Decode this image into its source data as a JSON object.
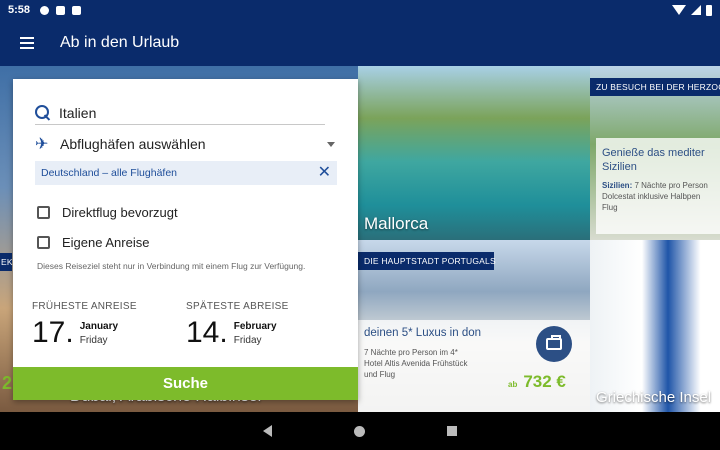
{
  "status_bar": {
    "time": "5:58",
    "icons": [
      "settings-icon",
      "a-icon",
      "sd-card-icon",
      "wifi-icon",
      "signal-icon",
      "battery-icon"
    ]
  },
  "app_bar": {
    "title": "Ab in den Urlaub",
    "menu_icon": "hamburger-menu-icon"
  },
  "search_panel": {
    "destination": "Italien",
    "airport_select_label": "Abflughäfen auswählen",
    "selected_airports": "Deutschland  – alle Flughäfen",
    "direct_flight_label": "Direktflug bevorzugt",
    "direct_flight_checked": false,
    "own_travel_label": "Eigene Anreise",
    "own_travel_checked": false,
    "note": "Dieses Reiseziel steht nur in Verbindung mit einem Flug zur Verfügung.",
    "earliest": {
      "label": "FRÜHESTE ANREISE",
      "day": "17.",
      "month": "January",
      "weekday": "Friday"
    },
    "latest": {
      "label": "SPÄTESTE ABREISE",
      "day": "14.",
      "month": "February",
      "weekday": "Friday"
    },
    "submit_label": "Suche"
  },
  "tiles": {
    "mallorca_label": "Mallorca",
    "sizilien": {
      "banner": "ZU BESUCH BEI DER HERZOG",
      "heading": "Genieße das mediter Sizilien",
      "region": "Sizilien:",
      "desc": "7 Nächte pro Person Dolcestat inklusive Halbpen Flug"
    },
    "lissabon": {
      "banner": "DIE HAUPTSTADT PORTUGALS",
      "heading": "deinen 5* Luxus in don",
      "desc": "7 Nächte pro Person im 4* Hotel Altis Avenida Frühstück und Flug",
      "price_prefix": "ab",
      "price": "732 €"
    },
    "left": {
      "banner": "EK",
      "price_fragment": "2",
      "label": "Dubai, Arabische Halbinsel"
    },
    "greece_label": "Griechische Insel"
  },
  "colors": {
    "primary": "#0a2b6b",
    "accent_blue": "#1f4e9a",
    "green": "#7dbb2b"
  }
}
